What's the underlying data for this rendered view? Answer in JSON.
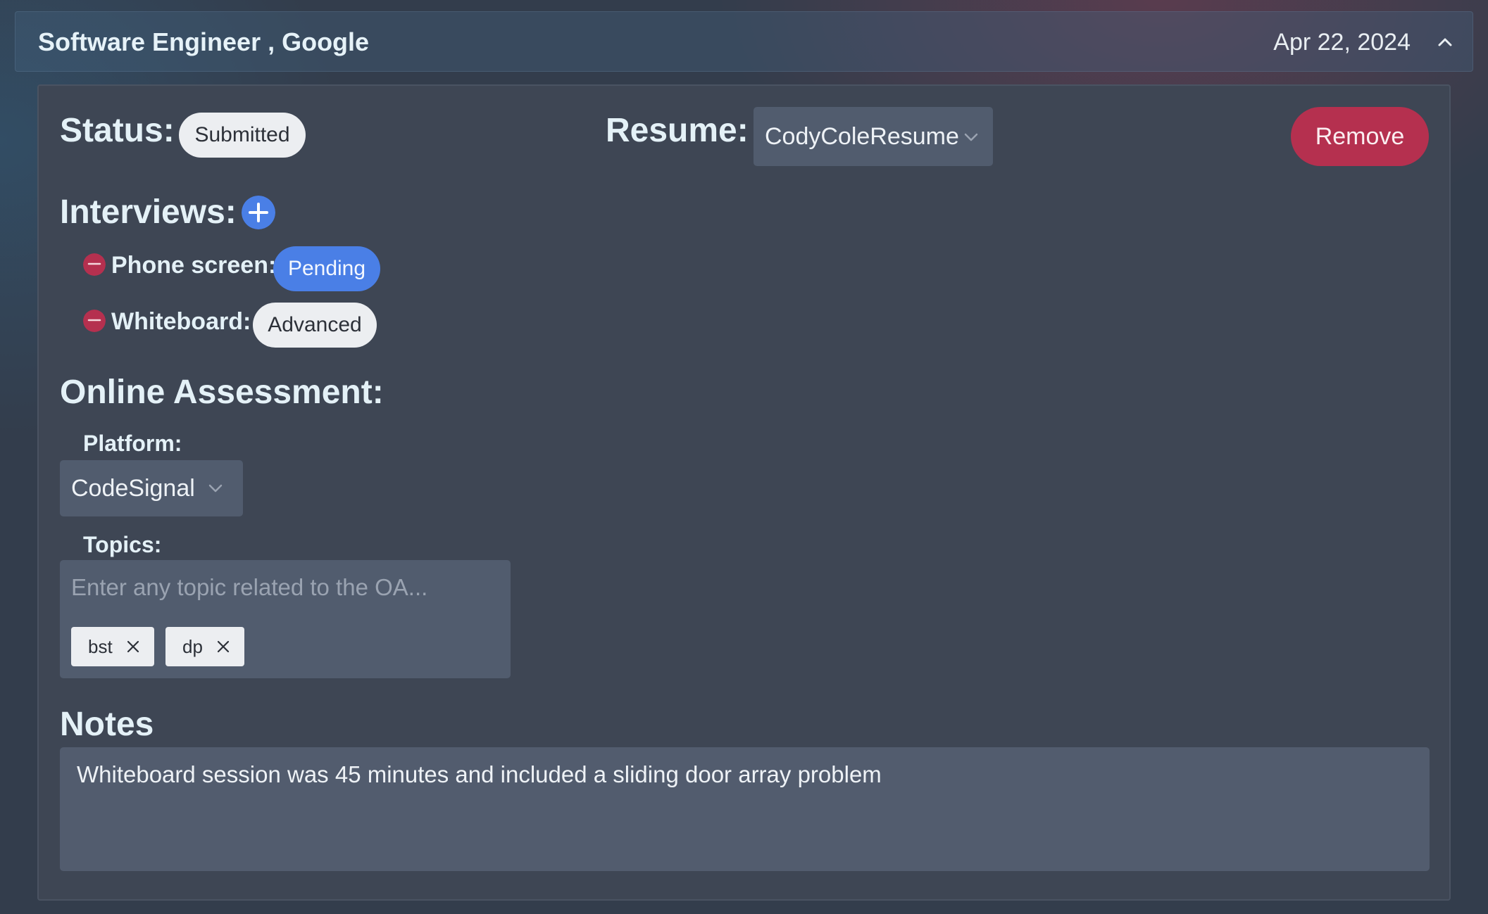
{
  "header": {
    "title": "Software Engineer , Google",
    "date": "Apr 22, 2024",
    "collapse_icon": "chevron-up-icon"
  },
  "status": {
    "label": "Status:",
    "value": "Submitted"
  },
  "resume": {
    "label": "Resume:",
    "selected": "CodyColeResume"
  },
  "remove_label": "Remove",
  "interviews": {
    "label": "Interviews:",
    "add_icon": "plus-circle-icon",
    "items": [
      {
        "name": "Phone screen:",
        "status": "Pending",
        "status_color": "#4a7fe6"
      },
      {
        "name": "Whiteboard:",
        "status": "Advanced",
        "status_color": "#eceef1"
      }
    ]
  },
  "online_assessment": {
    "label": "Online Assessment:",
    "platform_label": "Platform:",
    "platform_selected": "CodeSignal",
    "topics_label": "Topics:",
    "topics_placeholder": "Enter any topic related to the OA...",
    "topics": [
      "bst",
      "dp"
    ]
  },
  "notes": {
    "label": "Notes",
    "value": "Whiteboard session was 45 minutes and included a sliding door array problem"
  },
  "colors": {
    "accent_blue": "#4a7fe6",
    "danger": "#b5304f",
    "panel": "#3e4654"
  }
}
